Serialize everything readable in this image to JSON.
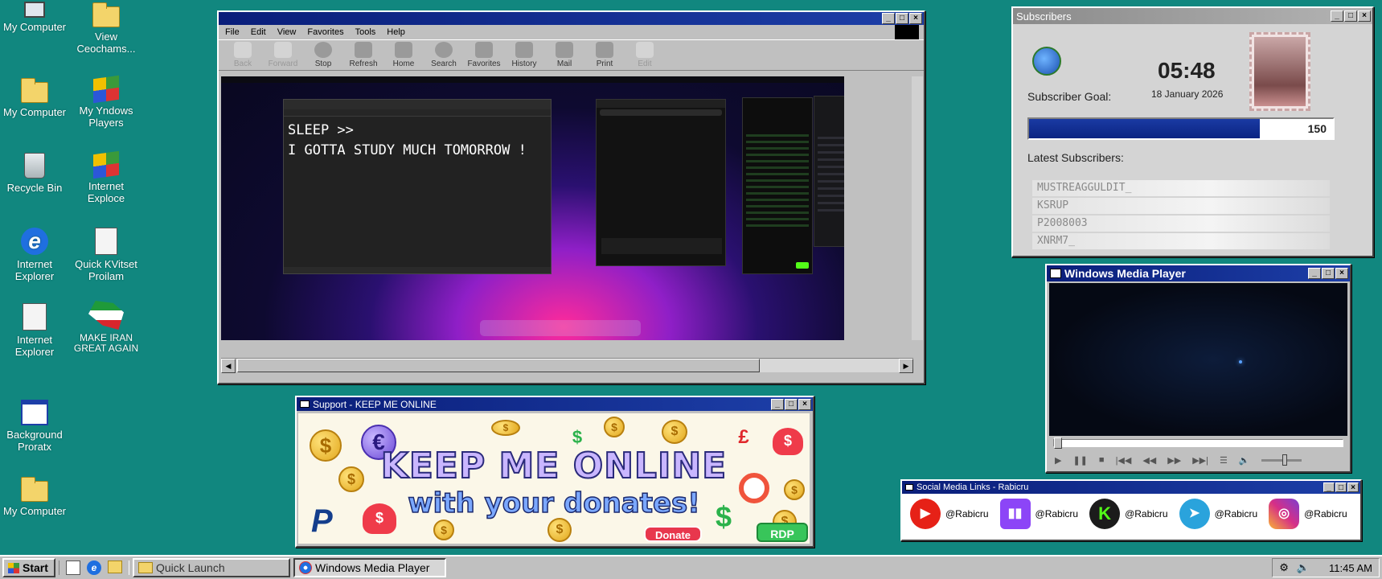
{
  "desktop": {
    "icons": [
      {
        "label": "My Computer"
      },
      {
        "label": "View Ceochams..."
      },
      {
        "label": "My Computer"
      },
      {
        "label": "My Yndows Players"
      },
      {
        "label": "Recycle Bin"
      },
      {
        "label": "Internet Exploce"
      },
      {
        "label": "Internet Explorer"
      },
      {
        "label": "Quick KVitset Proilam"
      },
      {
        "label": "Internet Explorer"
      },
      {
        "label": "MAKE IRAN GREAT AGAIN"
      },
      {
        "label": "Background Proratx"
      },
      {
        "label": "My Computer"
      }
    ]
  },
  "browser": {
    "menu": [
      "File",
      "Edit",
      "View",
      "Favorites",
      "Tools",
      "Help"
    ],
    "toolbar": [
      {
        "label": "Back",
        "enabled": false
      },
      {
        "label": "Forward",
        "enabled": false
      },
      {
        "label": "Stop",
        "enabled": true
      },
      {
        "label": "Refresh",
        "enabled": true
      },
      {
        "label": "Home",
        "enabled": true
      },
      {
        "label": "Search",
        "enabled": true
      },
      {
        "label": "Favorites",
        "enabled": true
      },
      {
        "label": "History",
        "enabled": true
      },
      {
        "label": "Mail",
        "enabled": true
      },
      {
        "label": "Print",
        "enabled": true
      },
      {
        "label": "Edit",
        "enabled": false
      }
    ],
    "notepad_text": "SLEEP >>\nI GOTTA STUDY MUCH TOMORROW !"
  },
  "support": {
    "title": "Support - KEEP ME ONLINE",
    "headline": "KEEP ME ONLINE",
    "subline": "with your donates!",
    "donate_label": "Donate",
    "rdp_label": "RDP"
  },
  "subscribers": {
    "title": "Subscribers",
    "time": "05:48",
    "date": "18 January 2026",
    "goal_label": "Subscriber Goal:",
    "goal_value": "150",
    "goal_progress": 0.76,
    "latest_label": "Latest Subscribers:",
    "list": [
      "MUSTREAGGULDIT_",
      "KSRUP",
      "P2008003",
      "XNRM7_"
    ]
  },
  "media_player": {
    "title": "Windows Media Player"
  },
  "social": {
    "title": "Social Media Links - Rabicru",
    "links": [
      {
        "platform": "youtube-icon",
        "handle": "@Rabicru",
        "color": "#e62117"
      },
      {
        "platform": "twitch-icon",
        "handle": "@Rabicru",
        "color": "#8c45f7"
      },
      {
        "platform": "kick-icon",
        "handle": "@Rabicru",
        "color": "#1b1b1b"
      },
      {
        "platform": "telegram-icon",
        "handle": "@Rabicru",
        "color": "#2aa3dc"
      },
      {
        "platform": "instagram-icon",
        "handle": "@Rabicru",
        "color": "#d62f86"
      }
    ]
  },
  "taskbar": {
    "start_label": "Start",
    "quick_launch_label": "Quick Launch",
    "active_task_label": "Windows Media Player",
    "clock": "11:45 AM"
  }
}
